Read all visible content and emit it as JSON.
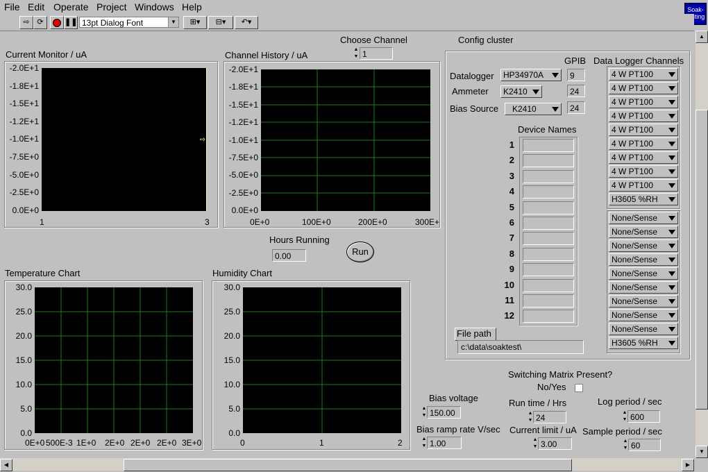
{
  "menu": [
    "File",
    "Edit",
    "Operate",
    "Project",
    "Windows",
    "Help"
  ],
  "toolbar": {
    "font_select": "13pt Dialog Font"
  },
  "app_badge": {
    "line1": "Soak-",
    "line2": "testing"
  },
  "channel": {
    "label": "Choose Channel",
    "value": "1"
  },
  "config": {
    "title": "Config cluster",
    "gpib_label": "GPIB",
    "dl_channels_label": "Data Logger Channels",
    "datalogger": {
      "label": "Datalogger",
      "value": "HP34970A",
      "gpib": "9"
    },
    "ammeter": {
      "label": "Ammeter",
      "value": "K2410",
      "gpib": "24"
    },
    "bias_source": {
      "label": "Bias Source",
      "value": "K2410",
      "gpib": "24"
    },
    "device_names_label": "Device Names",
    "device_numbers": [
      "1",
      "2",
      "3",
      "4",
      "5",
      "6",
      "7",
      "8",
      "9",
      "10",
      "11",
      "12"
    ],
    "dl_channels_a": [
      "4 W PT100",
      "4 W PT100",
      "4 W PT100",
      "4 W PT100",
      "4 W PT100",
      "4 W PT100",
      "4 W PT100",
      "4 W PT100",
      "4 W PT100",
      "H3605 %RH"
    ],
    "dl_channels_b": [
      "None/Sense",
      "None/Sense",
      "None/Sense",
      "None/Sense",
      "None/Sense",
      "None/Sense",
      "None/Sense",
      "None/Sense",
      "None/Sense",
      "H3605 %RH"
    ],
    "file_path_label": "File path",
    "file_path": "c:\\data\\soaktest\\"
  },
  "current_monitor": {
    "label": "Current Monitor / uA",
    "yticks": [
      "-2.0E+1",
      "-1.8E+1",
      "-1.5E+1",
      "-1.2E+1",
      "-1.0E+1",
      "-7.5E+0",
      "-5.0E+0",
      "-2.5E+0",
      "0.0E+0"
    ],
    "xticks": [
      "1",
      "3"
    ]
  },
  "channel_history": {
    "label": "Channel History / uA",
    "yticks": [
      "-2.0E+1",
      "-1.8E+1",
      "-1.5E+1",
      "-1.2E+1",
      "-1.0E+1",
      "-7.5E+0",
      "-5.0E+0",
      "-2.5E+0",
      "0.0E+0"
    ],
    "xticks": [
      "0E+0",
      "100E+0",
      "200E+0",
      "300E+"
    ]
  },
  "hours_running": {
    "label": "Hours Running",
    "value": "0.00"
  },
  "run_button": "Run",
  "temperature_chart": {
    "label": "Temperature Chart",
    "yticks": [
      "30.0",
      "25.0",
      "20.0",
      "15.0",
      "10.0",
      "5.0",
      "0.0"
    ],
    "xticks": [
      "0E+0",
      "500E-3",
      "1E+0",
      "2E+0",
      "2E+0",
      "2E+0",
      "3E+0"
    ]
  },
  "humidity_chart": {
    "label": "Humidity Chart",
    "yticks": [
      "30.0",
      "25.0",
      "20.0",
      "15.0",
      "10.0",
      "5.0",
      "0.0"
    ],
    "xticks": [
      "0",
      "1",
      "2"
    ]
  },
  "switching": {
    "label": "Switching Matrix Present?",
    "toggle_label": "No/Yes"
  },
  "bias_voltage": {
    "label": "Bias voltage",
    "value": "150.00"
  },
  "bias_ramp": {
    "label": "Bias ramp rate V/sec",
    "value": "1.00"
  },
  "run_time": {
    "label": "Run time / Hrs",
    "value": "24"
  },
  "current_limit": {
    "label": "Current limit / uA",
    "value": "3.00"
  },
  "log_period": {
    "label": "Log period / sec",
    "value": "600"
  },
  "sample_period": {
    "label": "Sample period / sec",
    "value": "60"
  }
}
